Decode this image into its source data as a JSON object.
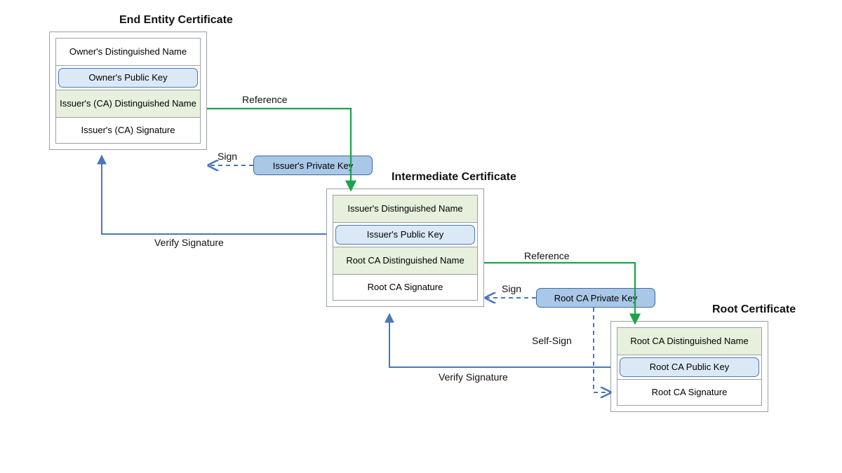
{
  "titles": {
    "end": "End Entity Certificate",
    "intermediate": "Intermediate Certificate",
    "root": "Root Certificate"
  },
  "end_cert": {
    "owner_dn": "Owner's Distinguished Name",
    "owner_key": "Owner's Public Key",
    "issuer_dn": "Issuer's  (CA) Distinguished Name",
    "signature": "Issuer's (CA) Signature"
  },
  "intermediate_cert": {
    "issuer_dn": "Issuer's Distinguished Name",
    "issuer_key": "Issuer's Public Key",
    "root_dn": "Root CA Distinguished Name",
    "signature": "Root CA Signature"
  },
  "root_cert": {
    "root_dn": "Root CA Distinguished Name",
    "root_key": "Root CA Public Key",
    "signature": "Root CA Signature"
  },
  "floating_keys": {
    "issuer_priv": "Issuer's Private  Key",
    "root_priv": "Root CA Private  Key"
  },
  "labels": {
    "reference1": "Reference",
    "reference2": "Reference",
    "sign1": "Sign",
    "sign2": "Sign",
    "verify1": "Verify Signature",
    "verify2": "Verify Signature",
    "selfsign": "Self-Sign"
  }
}
